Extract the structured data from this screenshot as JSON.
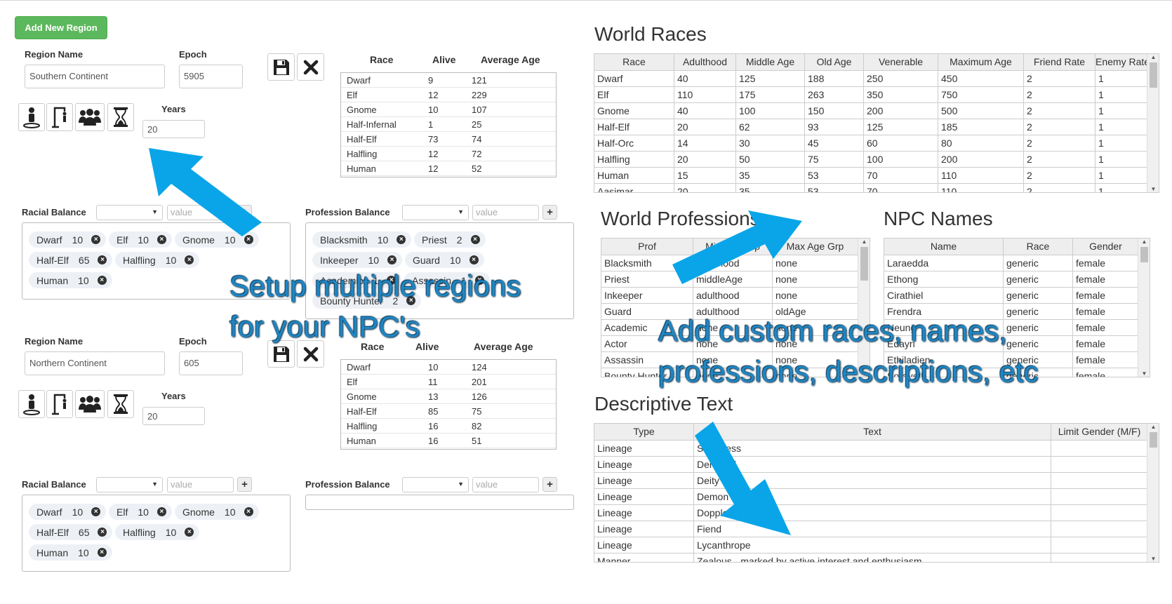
{
  "add_region_label": "Add New Region",
  "labels": {
    "region_name": "Region Name",
    "epoch": "Epoch",
    "years": "Years",
    "racial_balance": "Racial Balance",
    "profession_balance": "Profession Balance",
    "value_placeholder": "value",
    "race": "Race",
    "alive": "Alive",
    "average_age": "Average Age"
  },
  "icons": {
    "save": "floppy-disk-icon",
    "delete": "close-icon",
    "person": "person-icon",
    "gallows": "gallows-icon",
    "group": "group-icon",
    "hourglass": "hourglass-icon"
  },
  "regions": [
    {
      "name": "Southern Continent",
      "epoch": "5905",
      "years": "20",
      "summary": [
        {
          "race": "Dwarf",
          "alive": "9",
          "avg": "121"
        },
        {
          "race": "Elf",
          "alive": "12",
          "avg": "229"
        },
        {
          "race": "Gnome",
          "alive": "10",
          "avg": "107"
        },
        {
          "race": "Half-Infernal",
          "alive": "1",
          "avg": "25"
        },
        {
          "race": "Half-Elf",
          "alive": "73",
          "avg": "74"
        },
        {
          "race": "Halfling",
          "alive": "12",
          "avg": "72"
        },
        {
          "race": "Human",
          "alive": "12",
          "avg": "52"
        }
      ],
      "racial_tags": [
        {
          "name": "Dwarf",
          "value": "10"
        },
        {
          "name": "Elf",
          "value": "10"
        },
        {
          "name": "Gnome",
          "value": "10"
        },
        {
          "name": "Half-Elf",
          "value": "65"
        },
        {
          "name": "Halfling",
          "value": "10"
        },
        {
          "name": "Human",
          "value": "10"
        }
      ],
      "profession_tags": [
        {
          "name": "Blacksmith",
          "value": "10"
        },
        {
          "name": "Priest",
          "value": "2"
        },
        {
          "name": "Inkeeper",
          "value": "10"
        },
        {
          "name": "Guard",
          "value": "10"
        },
        {
          "name": "Academic",
          "value": "1"
        },
        {
          "name": "Assassin",
          "value": "1"
        },
        {
          "name": "Bounty Hunter",
          "value": "2"
        }
      ]
    },
    {
      "name": "Northern Continent",
      "epoch": "605",
      "years": "20",
      "summary": [
        {
          "race": "Dwarf",
          "alive": "10",
          "avg": "124"
        },
        {
          "race": "Elf",
          "alive": "11",
          "avg": "201"
        },
        {
          "race": "Gnome",
          "alive": "13",
          "avg": "126"
        },
        {
          "race": "Half-Elf",
          "alive": "85",
          "avg": "75"
        },
        {
          "race": "Halfling",
          "alive": "16",
          "avg": "82"
        },
        {
          "race": "Human",
          "alive": "16",
          "avg": "51"
        }
      ],
      "racial_tags": [
        {
          "name": "Dwarf",
          "value": "10"
        },
        {
          "name": "Elf",
          "value": "10"
        },
        {
          "name": "Gnome",
          "value": "10"
        },
        {
          "name": "Half-Elf",
          "value": "65"
        },
        {
          "name": "Halfling",
          "value": "10"
        },
        {
          "name": "Human",
          "value": "10"
        }
      ],
      "profession_tags": []
    }
  ],
  "world_races": {
    "title": "World Races",
    "columns": [
      "Race",
      "Adulthood",
      "Middle Age",
      "Old Age",
      "Venerable",
      "Maximum Age",
      "Friend Rate",
      "Enemy Rate"
    ],
    "rows": [
      [
        "Dwarf",
        "40",
        "125",
        "188",
        "250",
        "450",
        "2",
        "1"
      ],
      [
        "Elf",
        "110",
        "175",
        "263",
        "350",
        "750",
        "2",
        "1"
      ],
      [
        "Gnome",
        "40",
        "100",
        "150",
        "200",
        "500",
        "2",
        "1"
      ],
      [
        "Half-Elf",
        "20",
        "62",
        "93",
        "125",
        "185",
        "2",
        "1"
      ],
      [
        "Half-Orc",
        "14",
        "30",
        "45",
        "60",
        "80",
        "2",
        "1"
      ],
      [
        "Halfling",
        "20",
        "50",
        "75",
        "100",
        "200",
        "2",
        "1"
      ],
      [
        "Human",
        "15",
        "35",
        "53",
        "70",
        "110",
        "2",
        "1"
      ],
      [
        "Aasimar",
        "20",
        "35",
        "53",
        "70",
        "110",
        "2",
        "1"
      ]
    ]
  },
  "world_professions": {
    "title": "World Professions",
    "columns": [
      "Prof",
      "Min Age Grp",
      "Max Age Grp"
    ],
    "rows": [
      [
        "Blacksmith",
        "adulthood",
        "none"
      ],
      [
        "Priest",
        "middleAge",
        "none"
      ],
      [
        "Inkeeper",
        "adulthood",
        "none"
      ],
      [
        "Guard",
        "adulthood",
        "oldAge"
      ],
      [
        "Academic",
        "none",
        "none"
      ],
      [
        "Actor",
        "none",
        "none"
      ],
      [
        "Assassin",
        "none",
        "none"
      ],
      [
        "Bounty Hunter",
        "none",
        "none"
      ]
    ]
  },
  "npc_names": {
    "title": "NPC Names",
    "columns": [
      "Name",
      "Race",
      "Gender"
    ],
    "rows": [
      [
        "Laraedda",
        "generic",
        "female"
      ],
      [
        "Ethong",
        "generic",
        "female"
      ],
      [
        "Cirathiel",
        "generic",
        "female"
      ],
      [
        "Frendra",
        "generic",
        "female"
      ],
      [
        "Neung",
        "generic",
        "female"
      ],
      [
        "Edayri",
        "generic",
        "female"
      ],
      [
        "Ethiladien",
        "generic",
        "female"
      ],
      [
        "Sorayeth",
        "generic",
        "female"
      ]
    ]
  },
  "descriptive_text": {
    "title": "Descriptive Text",
    "columns": [
      "Type",
      "Text",
      "Limit Gender (M/F)"
    ],
    "rows": [
      [
        "Lineage",
        "Sorceress",
        ""
      ],
      [
        "Lineage",
        "Demigod",
        ""
      ],
      [
        "Lineage",
        "Deity",
        ""
      ],
      [
        "Lineage",
        "Demon",
        ""
      ],
      [
        "Lineage",
        "Doppleganger",
        ""
      ],
      [
        "Lineage",
        "Fiend",
        ""
      ],
      [
        "Lineage",
        "Lycanthrope",
        ""
      ],
      [
        "Manner",
        "Zealous - marked by active interest and enthusiasm",
        ""
      ]
    ]
  },
  "overlays": {
    "regions_line1": "Setup multiple regions",
    "regions_line2": "for your NPC's",
    "custom_line1": "Add custom races, names,",
    "custom_line2": "professions, descriptions, etc"
  },
  "colors": {
    "accent_green": "#5cb85c",
    "arrow_blue": "#0aa5e8",
    "overlay_text": "#1d87c6"
  }
}
